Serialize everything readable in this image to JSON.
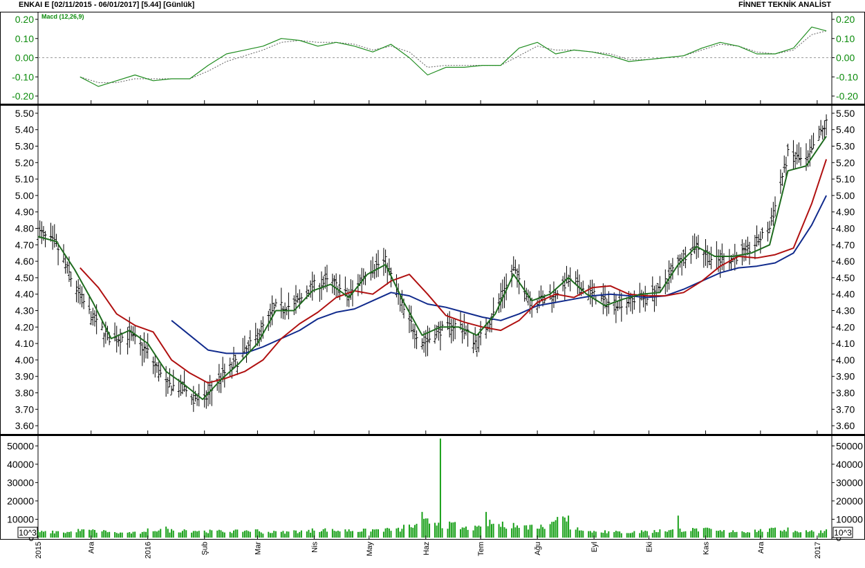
{
  "header": {
    "left": "ENKAI E  [02/11/2015 - 06/01/2017]  [5.44]  [Günlük]",
    "right": "FİNNET TEKNİK ANALİST"
  },
  "colors": {
    "price_bar": "#000000",
    "ma_short": "#1e6b1e",
    "ma_mid": "#b01010",
    "ma_long": "#102a8c",
    "macd_line": "#1e8c1e",
    "macd_signal": "#606060",
    "volume": "#19a019",
    "grid": "#9a9a9a"
  },
  "chart_data": [
    {
      "panel": "macd",
      "type": "line",
      "label": "Macd (12,26,9)",
      "ylim": [
        -0.2,
        0.2
      ],
      "y_ticks": [
        "0.20",
        "0.10",
        "0.00",
        "-0.10",
        "-0.20"
      ],
      "series": [
        {
          "role": "macd",
          "x": [
            "2015-11-25",
            "2015-12-05",
            "2015-12-15",
            "2015-12-25",
            "2016-01-04",
            "2016-01-14",
            "2016-01-24",
            "2016-02-03",
            "2016-02-13",
            "2016-02-23",
            "2016-03-04",
            "2016-03-14",
            "2016-03-24",
            "2016-04-03",
            "2016-04-13",
            "2016-04-23",
            "2016-05-03",
            "2016-05-13",
            "2016-05-23",
            "2016-06-02",
            "2016-06-12",
            "2016-06-22",
            "2016-07-02",
            "2016-07-12",
            "2016-07-22",
            "2016-08-01",
            "2016-08-11",
            "2016-08-21",
            "2016-08-31",
            "2016-09-10",
            "2016-09-20",
            "2016-09-30",
            "2016-10-10",
            "2016-10-20",
            "2016-10-30",
            "2016-11-09",
            "2016-11-19",
            "2016-11-29",
            "2016-12-09",
            "2016-12-19",
            "2016-12-29",
            "2017-01-06"
          ],
          "values": [
            -0.1,
            -0.15,
            -0.12,
            -0.09,
            -0.12,
            -0.11,
            -0.11,
            -0.04,
            0.02,
            0.04,
            0.06,
            0.1,
            0.09,
            0.06,
            0.08,
            0.06,
            0.03,
            0.07,
            0.0,
            -0.09,
            -0.05,
            -0.05,
            -0.04,
            -0.04,
            0.05,
            0.08,
            0.02,
            0.04,
            0.03,
            0.01,
            -0.02,
            -0.01,
            0.0,
            0.01,
            0.05,
            0.08,
            0.06,
            0.02,
            0.02,
            0.05,
            0.16,
            0.14
          ]
        },
        {
          "role": "signal",
          "x": [
            "2015-11-25",
            "2015-12-05",
            "2015-12-15",
            "2015-12-25",
            "2016-01-04",
            "2016-01-14",
            "2016-01-24",
            "2016-02-03",
            "2016-02-13",
            "2016-02-23",
            "2016-03-04",
            "2016-03-14",
            "2016-03-24",
            "2016-04-03",
            "2016-04-13",
            "2016-04-23",
            "2016-05-03",
            "2016-05-13",
            "2016-05-23",
            "2016-06-02",
            "2016-06-12",
            "2016-06-22",
            "2016-07-02",
            "2016-07-12",
            "2016-07-22",
            "2016-08-01",
            "2016-08-11",
            "2016-08-21",
            "2016-08-31",
            "2016-09-10",
            "2016-09-20",
            "2016-09-30",
            "2016-10-10",
            "2016-10-20",
            "2016-10-30",
            "2016-11-09",
            "2016-11-19",
            "2016-11-29",
            "2016-12-09",
            "2016-12-19",
            "2016-12-29",
            "2017-01-06"
          ],
          "values": [
            -0.1,
            -0.13,
            -0.13,
            -0.11,
            -0.11,
            -0.11,
            -0.11,
            -0.07,
            -0.02,
            0.01,
            0.04,
            0.08,
            0.09,
            0.08,
            0.08,
            0.07,
            0.04,
            0.06,
            0.03,
            -0.05,
            -0.04,
            -0.04,
            -0.04,
            -0.04,
            0.01,
            0.06,
            0.04,
            0.04,
            0.03,
            0.02,
            -0.01,
            -0.01,
            0.0,
            0.01,
            0.04,
            0.07,
            0.06,
            0.03,
            0.02,
            0.04,
            0.12,
            0.14
          ]
        }
      ]
    },
    {
      "panel": "price",
      "type": "ohlc",
      "ylim": [
        3.55,
        5.55
      ],
      "y_ticks": [
        "5.50",
        "5.40",
        "5.30",
        "5.20",
        "5.10",
        "5.00",
        "4.90",
        "4.80",
        "4.70",
        "4.60",
        "4.50",
        "4.40",
        "4.30",
        "4.20",
        "4.10",
        "4.00",
        "3.90",
        "3.80",
        "3.70",
        "3.60"
      ],
      "series": [
        {
          "role": "close",
          "x": [
            "2015-11-02",
            "2015-11-12",
            "2015-11-22",
            "2015-12-02",
            "2015-12-12",
            "2015-12-22",
            "2016-01-01",
            "2016-01-11",
            "2016-01-21",
            "2016-01-31",
            "2016-02-10",
            "2016-02-20",
            "2016-03-01",
            "2016-03-11",
            "2016-03-21",
            "2016-03-31",
            "2016-04-10",
            "2016-04-20",
            "2016-04-30",
            "2016-05-10",
            "2016-05-20",
            "2016-05-30",
            "2016-06-09",
            "2016-06-19",
            "2016-06-29",
            "2016-07-09",
            "2016-07-19",
            "2016-07-29",
            "2016-08-08",
            "2016-08-18",
            "2016-08-28",
            "2016-09-07",
            "2016-09-17",
            "2016-09-27",
            "2016-10-07",
            "2016-10-17",
            "2016-10-27",
            "2016-11-06",
            "2016-11-16",
            "2016-11-26",
            "2016-12-06",
            "2016-12-16",
            "2016-12-26",
            "2017-01-06"
          ],
          "values": [
            4.78,
            4.7,
            4.45,
            4.25,
            4.12,
            4.15,
            4.05,
            3.85,
            3.82,
            3.74,
            3.9,
            4.0,
            4.15,
            4.32,
            4.33,
            4.45,
            4.48,
            4.38,
            4.55,
            4.6,
            4.3,
            4.1,
            4.18,
            4.22,
            4.1,
            4.3,
            4.55,
            4.35,
            4.38,
            4.48,
            4.42,
            4.35,
            4.35,
            4.38,
            4.42,
            4.6,
            4.7,
            4.6,
            4.62,
            4.68,
            4.8,
            5.25,
            5.2,
            5.44
          ]
        },
        {
          "role": "ma_short",
          "x": [
            "2015-11-02",
            "2015-11-12",
            "2015-11-22",
            "2015-12-02",
            "2015-12-12",
            "2015-12-22",
            "2016-01-01",
            "2016-01-11",
            "2016-01-21",
            "2016-01-31",
            "2016-02-10",
            "2016-02-20",
            "2016-03-01",
            "2016-03-11",
            "2016-03-21",
            "2016-03-31",
            "2016-04-10",
            "2016-04-20",
            "2016-04-30",
            "2016-05-10",
            "2016-05-20",
            "2016-05-30",
            "2016-06-09",
            "2016-06-19",
            "2016-06-29",
            "2016-07-09",
            "2016-07-19",
            "2016-07-29",
            "2016-08-08",
            "2016-08-18",
            "2016-08-28",
            "2016-09-07",
            "2016-09-17",
            "2016-09-27",
            "2016-10-07",
            "2016-10-17",
            "2016-10-27",
            "2016-11-06",
            "2016-11-16",
            "2016-11-26",
            "2016-12-06",
            "2016-12-16",
            "2016-12-26",
            "2017-01-06"
          ],
          "values": [
            4.75,
            4.72,
            4.55,
            4.35,
            4.13,
            4.18,
            4.1,
            3.93,
            3.85,
            3.76,
            3.88,
            3.98,
            4.1,
            4.3,
            4.3,
            4.42,
            4.46,
            4.38,
            4.52,
            4.58,
            4.35,
            4.15,
            4.2,
            4.2,
            4.15,
            4.28,
            4.52,
            4.36,
            4.4,
            4.5,
            4.4,
            4.33,
            4.37,
            4.4,
            4.41,
            4.58,
            4.69,
            4.63,
            4.63,
            4.65,
            4.7,
            5.15,
            5.18,
            5.36
          ]
        },
        {
          "role": "ma_mid",
          "x": [
            "2015-11-25",
            "2015-12-05",
            "2015-12-15",
            "2015-12-25",
            "2016-01-04",
            "2016-01-14",
            "2016-01-24",
            "2016-02-03",
            "2016-02-13",
            "2016-02-23",
            "2016-03-04",
            "2016-03-14",
            "2016-03-24",
            "2016-04-03",
            "2016-04-13",
            "2016-04-23",
            "2016-05-03",
            "2016-05-13",
            "2016-05-23",
            "2016-06-02",
            "2016-06-12",
            "2016-06-22",
            "2016-07-02",
            "2016-07-12",
            "2016-07-22",
            "2016-08-01",
            "2016-08-11",
            "2016-08-21",
            "2016-08-31",
            "2016-09-10",
            "2016-09-20",
            "2016-09-30",
            "2016-10-10",
            "2016-10-20",
            "2016-10-30",
            "2016-11-09",
            "2016-11-19",
            "2016-11-29",
            "2016-12-09",
            "2016-12-19",
            "2016-12-29",
            "2017-01-06"
          ],
          "values": [
            4.56,
            4.44,
            4.28,
            4.21,
            4.17,
            4.0,
            3.92,
            3.86,
            3.89,
            3.93,
            4.0,
            4.13,
            4.22,
            4.29,
            4.38,
            4.42,
            4.4,
            4.48,
            4.52,
            4.4,
            4.27,
            4.23,
            4.2,
            4.18,
            4.24,
            4.35,
            4.4,
            4.38,
            4.44,
            4.45,
            4.4,
            4.39,
            4.39,
            4.41,
            4.48,
            4.57,
            4.63,
            4.62,
            4.64,
            4.68,
            4.95,
            5.22
          ]
        },
        {
          "role": "ma_long",
          "x": [
            "2016-01-14",
            "2016-01-24",
            "2016-02-03",
            "2016-02-13",
            "2016-02-23",
            "2016-03-04",
            "2016-03-14",
            "2016-03-24",
            "2016-04-03",
            "2016-04-13",
            "2016-04-23",
            "2016-05-03",
            "2016-05-13",
            "2016-05-23",
            "2016-06-02",
            "2016-06-12",
            "2016-06-22",
            "2016-07-02",
            "2016-07-12",
            "2016-07-22",
            "2016-08-01",
            "2016-08-11",
            "2016-08-21",
            "2016-08-31",
            "2016-09-10",
            "2016-09-20",
            "2016-09-30",
            "2016-10-10",
            "2016-10-20",
            "2016-10-30",
            "2016-11-09",
            "2016-11-19",
            "2016-11-29",
            "2016-12-09",
            "2016-12-19",
            "2016-12-29",
            "2017-01-06"
          ],
          "values": [
            4.24,
            4.15,
            4.06,
            4.04,
            4.04,
            4.08,
            4.13,
            4.18,
            4.25,
            4.29,
            4.31,
            4.36,
            4.41,
            4.39,
            4.34,
            4.32,
            4.29,
            4.26,
            4.24,
            4.28,
            4.33,
            4.35,
            4.37,
            4.39,
            4.4,
            4.39,
            4.38,
            4.39,
            4.43,
            4.48,
            4.53,
            4.56,
            4.57,
            4.59,
            4.65,
            4.82,
            5.0
          ]
        }
      ]
    },
    {
      "panel": "volume",
      "type": "bar",
      "unit_label": "10^3",
      "ylim": [
        0,
        55000
      ],
      "y_ticks": [
        "50000",
        "40000",
        "30000",
        "20000",
        "10000",
        "0"
      ],
      "x": [
        "2015-11-02",
        "2015-11-12",
        "2015-11-22",
        "2015-12-02",
        "2015-12-12",
        "2015-12-22",
        "2016-01-01",
        "2016-01-11",
        "2016-01-21",
        "2016-01-31",
        "2016-02-10",
        "2016-02-20",
        "2016-03-01",
        "2016-03-11",
        "2016-03-21",
        "2016-03-31",
        "2016-04-10",
        "2016-04-20",
        "2016-04-30",
        "2016-05-10",
        "2016-05-20",
        "2016-05-30",
        "2016-06-05",
        "2016-06-09",
        "2016-06-19",
        "2016-06-29",
        "2016-07-04",
        "2016-07-09",
        "2016-07-19",
        "2016-07-29",
        "2016-08-06",
        "2016-08-18",
        "2016-08-28",
        "2016-09-07",
        "2016-09-17",
        "2016-09-27",
        "2016-10-07",
        "2016-10-17",
        "2016-10-27",
        "2016-11-06",
        "2016-11-16",
        "2016-11-26",
        "2016-12-06",
        "2016-12-16",
        "2016-12-26",
        "2017-01-06"
      ],
      "values": [
        4000,
        3500,
        5500,
        4500,
        4000,
        3000,
        5000,
        6000,
        4500,
        5000,
        4000,
        5500,
        4500,
        3500,
        4000,
        5000,
        5500,
        4500,
        6000,
        5000,
        7000,
        14000,
        10000,
        54000,
        8000,
        6000,
        14000,
        9000,
        8000,
        7000,
        14000,
        12000,
        6000,
        4000,
        3500,
        4000,
        4500,
        12000,
        5000,
        10000,
        4000,
        4500,
        5000,
        5500,
        4000,
        4500
      ]
    }
  ],
  "x_axis": {
    "tick_labels": [
      "2015",
      "Ara",
      "2016",
      "Şub",
      "Mar",
      "Nis",
      "May",
      "Haz",
      "Tem",
      "Ağu",
      "Eyl",
      "Eki",
      "Kas",
      "Ara",
      "2017"
    ],
    "tick_dates": [
      "2015-11-02",
      "2015-12-01",
      "2016-01-01",
      "2016-02-01",
      "2016-03-01",
      "2016-04-01",
      "2016-05-01",
      "2016-06-01",
      "2016-07-01",
      "2016-08-01",
      "2016-09-01",
      "2016-10-01",
      "2016-11-01",
      "2016-12-01",
      "2017-01-01"
    ]
  }
}
